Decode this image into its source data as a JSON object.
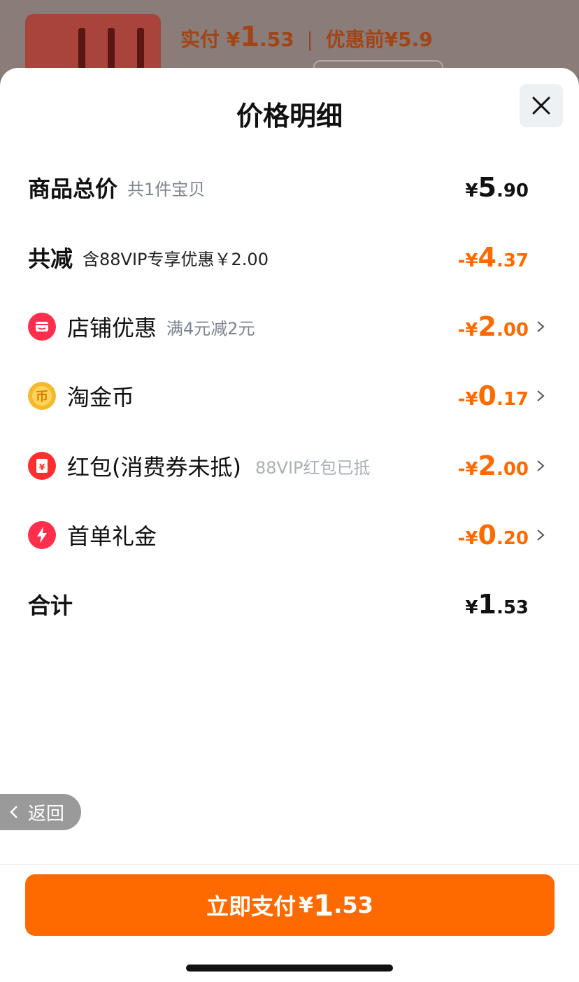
{
  "background": {
    "paid_label": "实付",
    "paid_currency": "¥",
    "paid_int": "1",
    "paid_dec": ".53",
    "separator": "|",
    "before_label": "优惠前",
    "before_value": "¥5.9"
  },
  "sheet": {
    "title": "价格明细",
    "close_icon": "close-icon"
  },
  "rows": [
    {
      "label": "商品总价",
      "sub": "共1件宝贝",
      "currency": "¥",
      "int": "5",
      "dec": ".90",
      "tone": "dark"
    },
    {
      "label": "共减",
      "sub": "含88VIP专享优惠￥2.00",
      "currency": "-¥",
      "int": "4",
      "dec": ".37",
      "tone": "orange"
    },
    {
      "label": "店铺优惠",
      "sub": "满4元减2元",
      "icon": "shop-icon",
      "currency": "-¥",
      "int": "2",
      "dec": ".00",
      "tone": "orange"
    },
    {
      "label": "淘金币",
      "sub": "",
      "icon": "coin-icon",
      "currency": "-¥",
      "int": "0",
      "dec": ".17",
      "tone": "orange"
    },
    {
      "label": "红包(消费券未抵)",
      "sub": "88VIP红包已抵",
      "icon": "red-packet-icon",
      "currency": "-¥",
      "int": "2",
      "dec": ".00",
      "tone": "orange"
    },
    {
      "label": "首单礼金",
      "sub": "",
      "icon": "lightning-icon",
      "currency": "-¥",
      "int": "0",
      "dec": ".20",
      "tone": "orange"
    },
    {
      "label": "合计",
      "sub": "",
      "currency": "¥",
      "int": "1",
      "dec": ".53",
      "tone": "dark"
    }
  ],
  "back": {
    "label": "返回"
  },
  "pay": {
    "label": "立即支付",
    "currency": "¥",
    "int": "1",
    "dec": ".53"
  },
  "colors": {
    "accent": "#ff6a00",
    "text": "#111111",
    "muted": "#7d8590"
  }
}
